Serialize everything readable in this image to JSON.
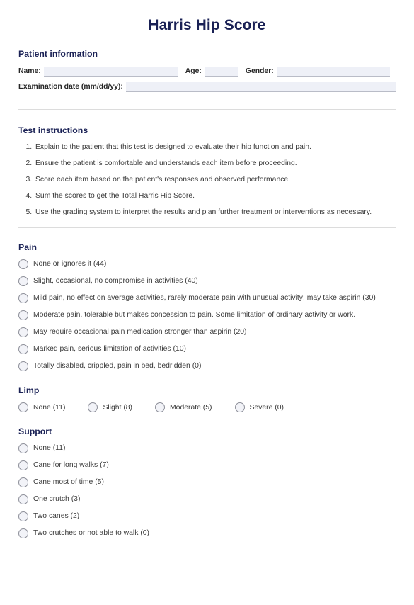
{
  "document": {
    "title": "Harris Hip Score"
  },
  "patient_information": {
    "heading": "Patient information",
    "fields": [
      {
        "label": "Name:",
        "value": ""
      },
      {
        "label": "Age:",
        "value": ""
      },
      {
        "label": "Gender:",
        "value": ""
      },
      {
        "label": "Examination date (mm/dd/yy):",
        "value": ""
      }
    ]
  },
  "test_instructions": {
    "heading": "Test instructions",
    "steps": [
      "Explain to the patient that this test is designed to evaluate their hip function and pain.",
      "Ensure the patient is comfortable and understands each item before proceeding.",
      "Score each item based on the patient's responses and observed performance.",
      "Sum the scores to get the Total Harris Hip Score.",
      "Use the grading system to interpret the results and plan further treatment or interventions as necessary."
    ]
  },
  "sections": [
    {
      "heading": "Pain",
      "layout": "stacked",
      "options": [
        {
          "label": "None or ignores it (44)",
          "score": 44
        },
        {
          "label": "Slight, occasional, no compromise in activities (40)",
          "score": 40
        },
        {
          "label": "Mild pain, no effect on average activities, rarely moderate pain with unusual activity; may take aspirin (30)",
          "score": 30
        },
        {
          "label": "Moderate pain, tolerable but makes concession to pain. Some limitation of ordinary activity or work.",
          "score": null
        },
        {
          "label": "May require occasional pain medication stronger than aspirin (20)",
          "score": 20
        },
        {
          "label": "Marked pain, serious limitation of activities (10)",
          "score": 10
        },
        {
          "label": "Totally disabled, crippled, pain in bed, bedridden (0)",
          "score": 0
        }
      ]
    },
    {
      "heading": "Limp",
      "layout": "inline",
      "options": [
        {
          "label": "None (11)",
          "score": 11
        },
        {
          "label": "Slight (8)",
          "score": 8
        },
        {
          "label": "Moderate (5)",
          "score": 5
        },
        {
          "label": "Severe (0)",
          "score": 0
        }
      ]
    },
    {
      "heading": "Support",
      "layout": "stacked",
      "options": [
        {
          "label": "None (11)",
          "score": 11
        },
        {
          "label": "Cane for long walks (7)",
          "score": 7
        },
        {
          "label": "Cane most of time (5)",
          "score": 5
        },
        {
          "label": "One crutch (3)",
          "score": 3
        },
        {
          "label": "Two canes (2)",
          "score": 2
        },
        {
          "label": "Two crutches or not able to walk (0)",
          "score": 0
        }
      ]
    }
  ],
  "colors": {
    "heading": "#1a2155",
    "body_text": "#3a3a3a",
    "field_fill": "#eef0f7",
    "divider": "#dcdcdc",
    "radio_border": "#8d8f99"
  }
}
